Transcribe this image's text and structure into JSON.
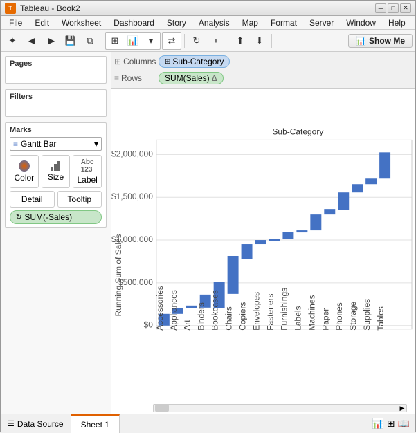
{
  "window": {
    "title": "Tableau - Book2",
    "icon": "T"
  },
  "titlebar": {
    "buttons": [
      "─",
      "□",
      "✕"
    ]
  },
  "menu": {
    "items": [
      "File",
      "Edit",
      "Worksheet",
      "Dashboard",
      "Story",
      "Analysis",
      "Map",
      "Format",
      "Server",
      "Window",
      "Help"
    ]
  },
  "toolbar": {
    "show_me": "Show Me",
    "show_me_icon": "📊"
  },
  "shelves": {
    "columns_label": "Columns",
    "rows_label": "Rows",
    "columns_pill": "Sub-Category",
    "rows_pill": "SUM(Sales)",
    "rows_delta": "Δ"
  },
  "pages": {
    "label": "Pages"
  },
  "filters": {
    "label": "Filters"
  },
  "marks": {
    "label": "Marks",
    "type": "Gantt Bar",
    "color": "Color",
    "size": "Size",
    "label_btn": "Label",
    "detail": "Detail",
    "tooltip": "Tooltip",
    "sum_pill": "SUM(-Sales)"
  },
  "chart": {
    "title": "Sub-Category",
    "y_label": "Running Sum of Sales",
    "y_ticks": [
      "$2,000,000",
      "$1,500,000",
      "$1,000,000",
      "$500,000",
      "$0"
    ],
    "x_labels": [
      "Accessories",
      "Appliances",
      "Art",
      "Binders",
      "Bookcases",
      "Chairs",
      "Copiers",
      "Envelopes",
      "Fasteners",
      "Furnishings",
      "Labels",
      "Machines",
      "Paper",
      "Phones",
      "Storage",
      "Supplies",
      "Tables"
    ],
    "bar_color": "#4472C4"
  },
  "tabs": {
    "datasource": "Data Source",
    "sheet": "Sheet 1"
  }
}
